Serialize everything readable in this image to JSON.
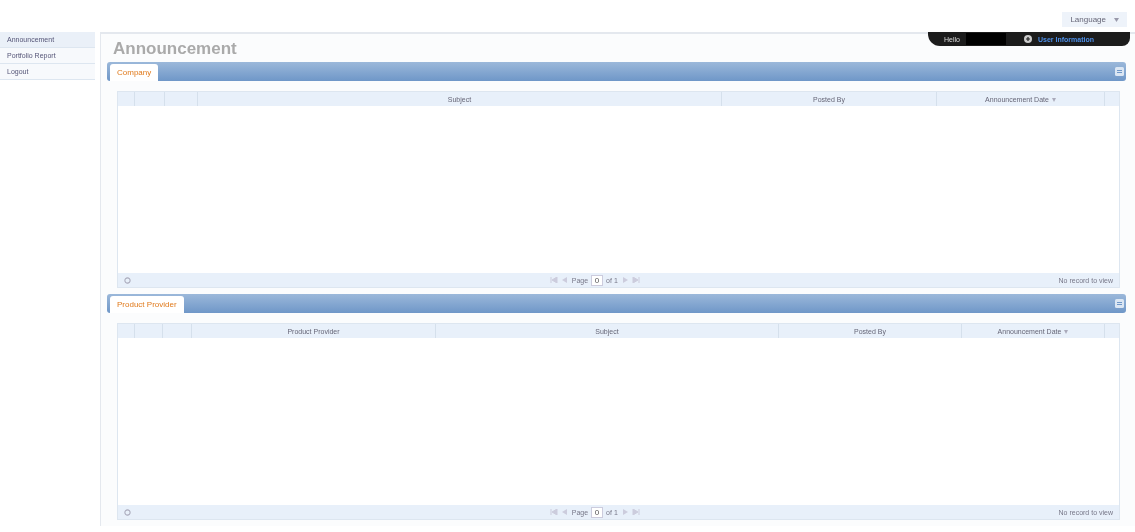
{
  "language": {
    "label": "Language"
  },
  "user_bar": {
    "greeting": "Hello",
    "link": "User Information"
  },
  "sidebar": {
    "items": [
      {
        "label": "Announcement",
        "selected": true
      },
      {
        "label": "Portfolio Report",
        "selected": false
      },
      {
        "label": "Logout",
        "selected": false
      }
    ]
  },
  "page_title": "Announcement",
  "panels": [
    {
      "tab": "Company",
      "columns": [
        {
          "label": "Subject",
          "sorted": false
        },
        {
          "label": "Posted By",
          "sorted": false
        },
        {
          "label": "Announcement Date",
          "sorted": true
        }
      ],
      "pager": {
        "page_label": "Page",
        "page": "0",
        "of": "of 1"
      },
      "status": "No record to view"
    },
    {
      "tab": "Product Provider",
      "columns": [
        {
          "label": "Product Provider",
          "sorted": false
        },
        {
          "label": "Subject",
          "sorted": false
        },
        {
          "label": "Posted By",
          "sorted": false
        },
        {
          "label": "Announcement Date",
          "sorted": true
        }
      ],
      "pager": {
        "page_label": "Page",
        "page": "0",
        "of": "of 1"
      },
      "status": "No record to view"
    }
  ]
}
